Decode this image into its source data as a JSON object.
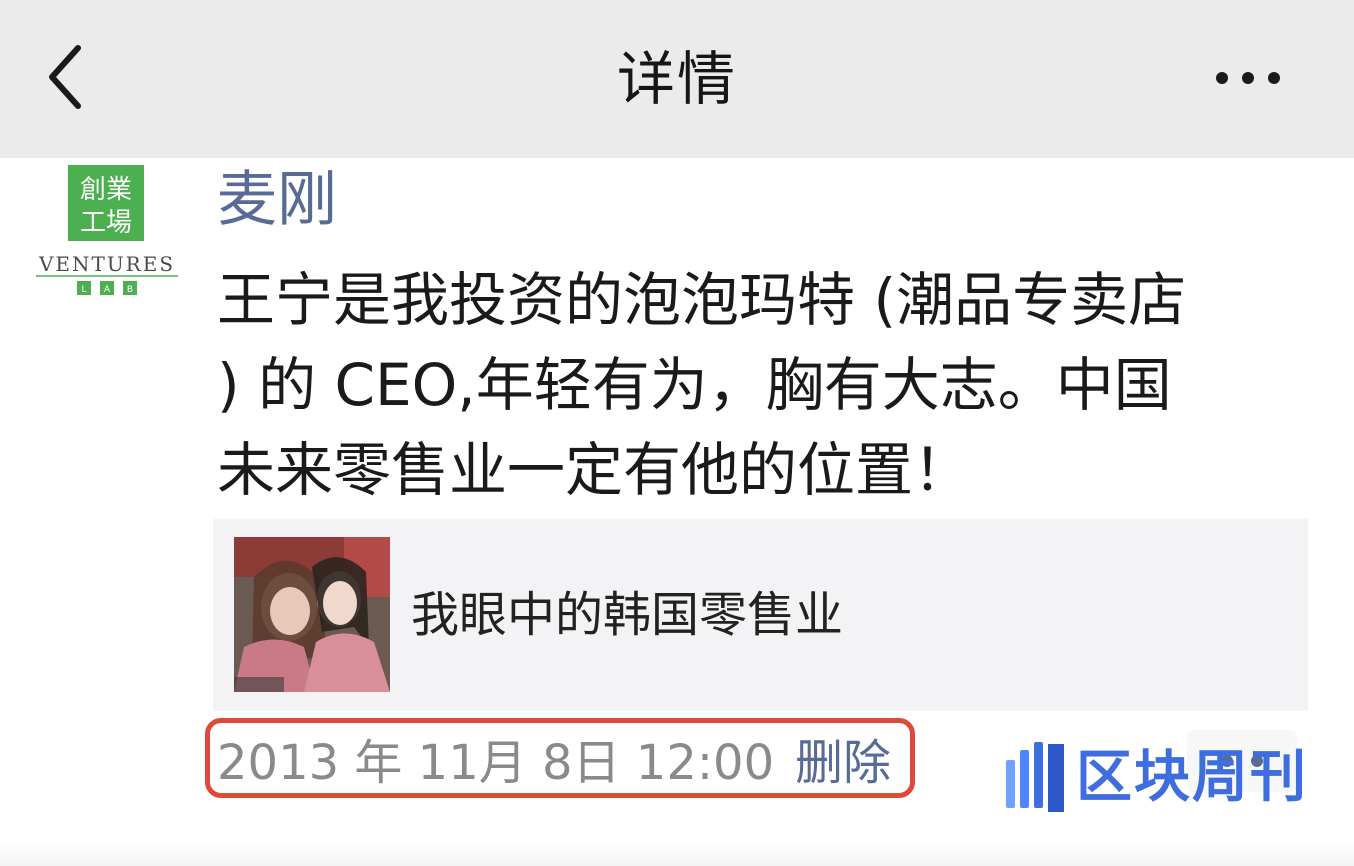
{
  "nav": {
    "title": "详情",
    "back_icon": "chevron-left-icon",
    "more_icon": "ellipsis-icon"
  },
  "post": {
    "avatar": {
      "logo_text_1": "創業",
      "logo_text_2": "工場",
      "brand_text": "VENTURES",
      "sub_text": "L A B",
      "logo_color": "#4caf50"
    },
    "author": "麦刚",
    "text": "王宁是我投资的泡泡玛特 (潮品专卖店\n) 的 CEO,年轻有为，胸有大志。中国\n未来零售业一定有他的位置！",
    "link_card": {
      "title": "我眼中的韩国零售业",
      "thumbnail": "photo-thumbnail"
    },
    "timestamp": "2013 年 11月 8日  12:00",
    "delete_label": "删除",
    "action_icon": "comment-dots-icon"
  },
  "watermark": {
    "text": "区块周刊",
    "color": "#3e6de0"
  },
  "colors": {
    "nav_bg": "#ebebeb",
    "link": "#576b95",
    "highlight_box": "#e0483a",
    "card_bg": "#f3f3f5"
  }
}
